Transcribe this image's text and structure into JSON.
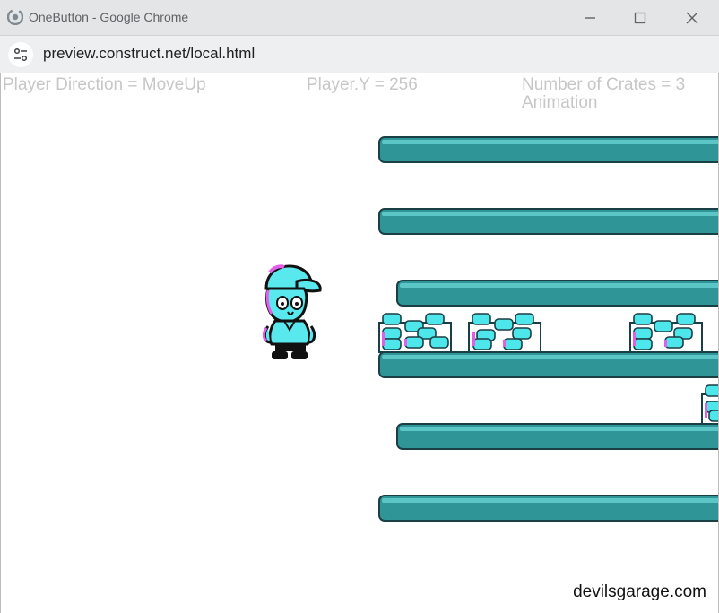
{
  "browser": {
    "window_title": "OneButton - Google Chrome",
    "url": "preview.construct.net/local.html",
    "icons": {
      "app": "chrome-logo-icon",
      "minimize": "minimize-icon",
      "maximize": "maximize-icon",
      "close": "close-icon",
      "site_info": "site-info-icon"
    }
  },
  "hud": {
    "direction_text": "Player Direction = MoveUp",
    "player_y_text": "Player.Y = 256",
    "crates_text": "Number of Crates = 3",
    "animation_text": "Animation"
  },
  "game": {
    "watermark": "devilsgarage.com",
    "colors": {
      "platform": "#2f9597",
      "platform_outline": "#1a3f44",
      "crate": "#4de6ea",
      "crate_accent": "#e25de8",
      "player": "#58e8ee"
    },
    "platform_count": 6,
    "crate_stacks": 4
  }
}
